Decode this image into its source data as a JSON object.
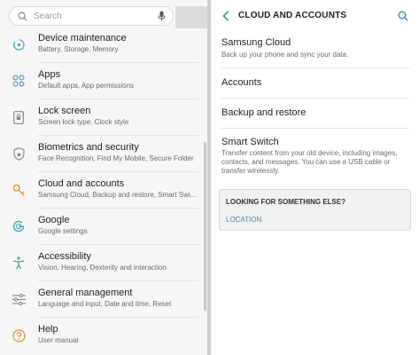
{
  "left_panel": {
    "search": {
      "placeholder": "Search"
    },
    "items": [
      {
        "title": "Device maintenance",
        "subtitle": "Battery, Storage, Memory",
        "icon": "device-maintenance-icon"
      },
      {
        "title": "Apps",
        "subtitle": "Default apps, App permissions",
        "icon": "apps-icon"
      },
      {
        "title": "Lock screen",
        "subtitle": "Screen lock type, Clock style",
        "icon": "lock-screen-icon"
      },
      {
        "title": "Biometrics and security",
        "subtitle": "Face Recognition, Find My Mobile, Secure Folder",
        "icon": "shield-icon"
      },
      {
        "title": "Cloud and accounts",
        "subtitle": "Samsung Cloud, Backup and restore, Smart Swi...",
        "icon": "key-icon"
      },
      {
        "title": "Google",
        "subtitle": "Google settings",
        "icon": "google-icon"
      },
      {
        "title": "Accessibility",
        "subtitle": "Vision, Hearing, Dexterity and interaction",
        "icon": "accessibility-icon"
      },
      {
        "title": "General management",
        "subtitle": "Language and input, Date and time, Reset",
        "icon": "sliders-icon"
      },
      {
        "title": "Help",
        "subtitle": "User manual",
        "icon": "help-icon"
      }
    ]
  },
  "right_panel": {
    "header": {
      "title": "CLOUD AND ACCOUNTS"
    },
    "items": [
      {
        "title": "Samsung Cloud",
        "subtitle": "Back up your phone and sync your data."
      },
      {
        "title": "Accounts",
        "subtitle": ""
      },
      {
        "title": "Backup and restore",
        "subtitle": ""
      },
      {
        "title": "Smart Switch",
        "subtitle": "Transfer content from your old device, including images, contacts, and messages. You can use a USB cable or transfer wirelessly."
      }
    ],
    "looking": {
      "title": "LOOKING FOR SOMETHING ELSE?",
      "link": "LOCATION"
    }
  },
  "colors": {
    "accent_teal": "#3e8ea8",
    "icon_grey": "#8a8a8a"
  }
}
